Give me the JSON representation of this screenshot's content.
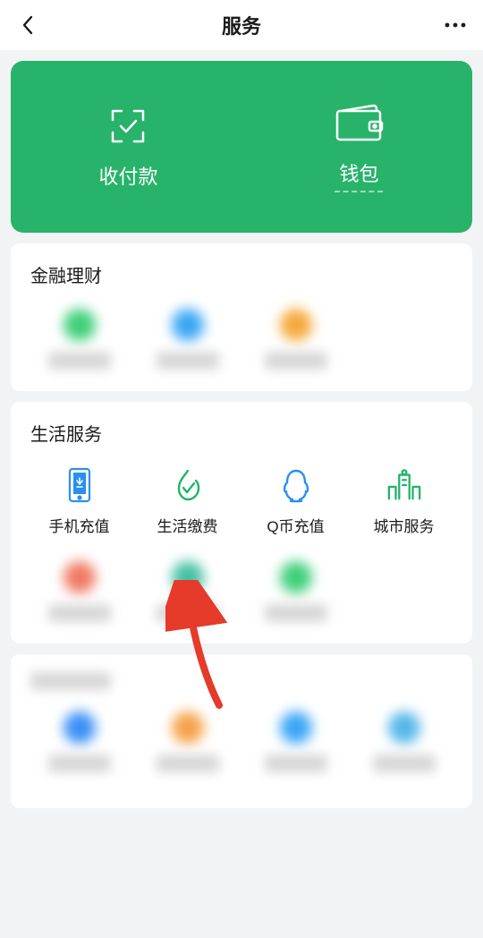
{
  "header": {
    "title": "服务"
  },
  "greenCard": {
    "pay": {
      "label": "收付款"
    },
    "wallet": {
      "label": "钱包"
    }
  },
  "sections": {
    "finance": {
      "title": "金融理财"
    },
    "life": {
      "title": "生活服务",
      "items": [
        {
          "label": "手机充值"
        },
        {
          "label": "生活缴费"
        },
        {
          "label": "Q币充值"
        },
        {
          "label": "城市服务"
        }
      ]
    }
  }
}
